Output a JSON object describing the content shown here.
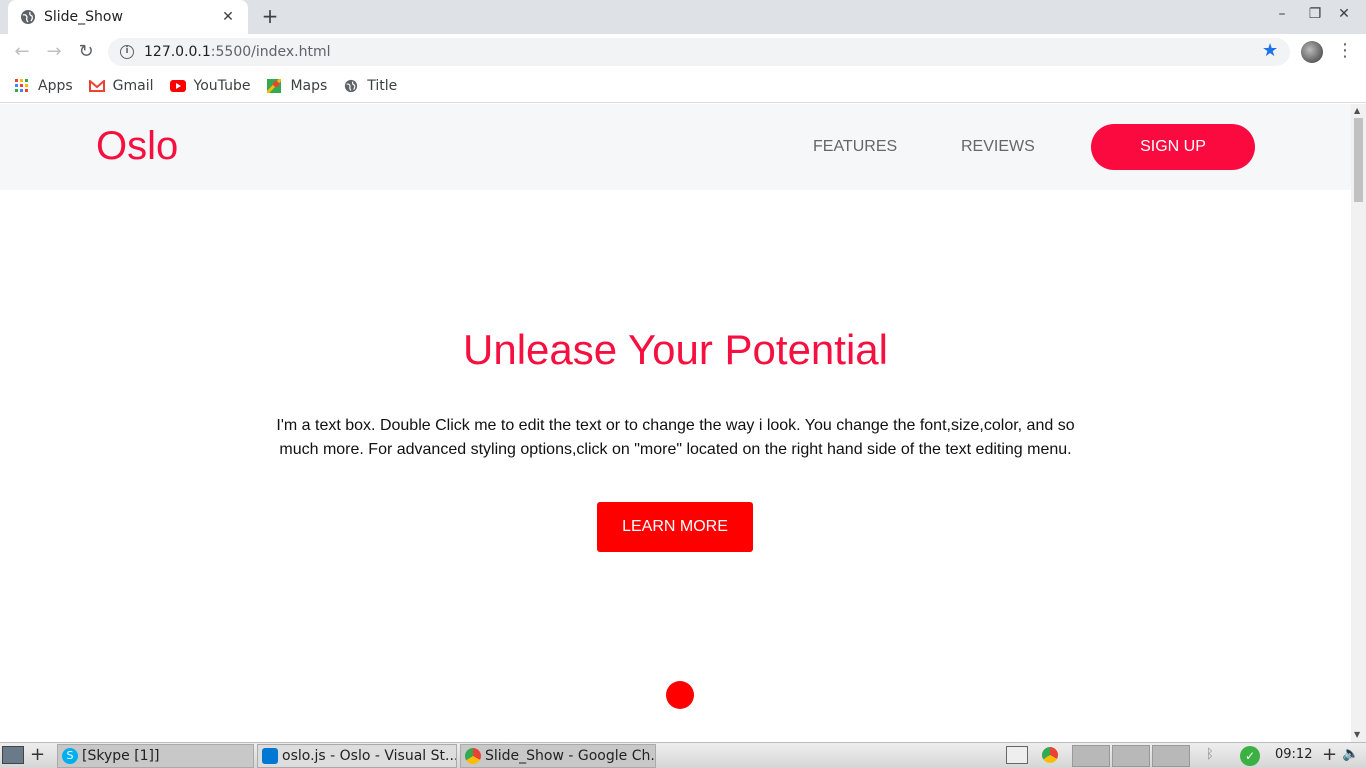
{
  "browser": {
    "tab_title": "Slide_Show",
    "tab_close": "✕",
    "new_tab": "+",
    "window_controls": [
      "–",
      "❐",
      "✕"
    ],
    "url_host": "127.0.0.1",
    "url_path": ":5500/index.html",
    "bookmarks": [
      {
        "label": "Apps",
        "icon": "apps-grid-icon"
      },
      {
        "label": "Gmail",
        "icon": "gmail-icon"
      },
      {
        "label": "YouTube",
        "icon": "youtube-icon"
      },
      {
        "label": "Maps",
        "icon": "maps-icon"
      },
      {
        "label": "Title",
        "icon": "globe-icon"
      }
    ]
  },
  "site": {
    "logo": "Oslo",
    "nav": {
      "features": "FEATURES",
      "reviews": "REVIEWS",
      "signup": "SIGN UP"
    },
    "hero": {
      "title": "Unlease Your Potential",
      "text": "I'm a text box. Double Click me to edit the text or to change the way i look. You change the font,size,color, and so much more. For advanced styling options,click on \"more\" located on the right hand side of the text editing menu.",
      "button": "LEARN MORE"
    },
    "colors": {
      "accent": "#f5103f",
      "button_red": "#ff0000"
    }
  },
  "taskbar": {
    "tasks": [
      {
        "label": "[Skype [1]]",
        "icon": "skype-icon"
      },
      {
        "label": "oslo.js - Oslo - Visual St...",
        "icon": "vscode-icon"
      },
      {
        "label": "Slide_Show - Google Ch...",
        "icon": "chrome-icon"
      }
    ],
    "clock": "09:12"
  }
}
